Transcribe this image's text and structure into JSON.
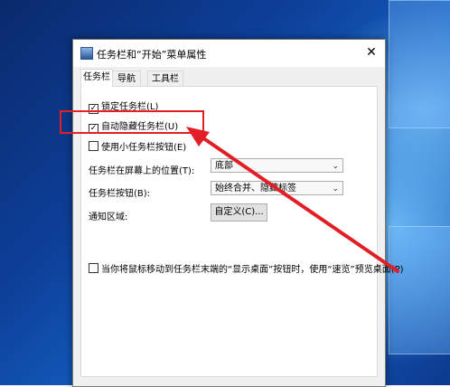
{
  "dialog": {
    "title": "任务栏和“开始”菜单属性",
    "close_glyph": "✕"
  },
  "tabs": [
    {
      "label": "任务栏",
      "active": true
    },
    {
      "label": "导航",
      "active": false
    },
    {
      "label": "工具栏",
      "active": false
    }
  ],
  "options": {
    "lock_taskbar": {
      "label": "锁定任务栏(L)",
      "checked": true
    },
    "auto_hide": {
      "label": "自动隐藏任务栏(U)",
      "checked": true
    },
    "small_buttons": {
      "label": "使用小任务栏按钮(E)",
      "checked": false
    },
    "peek": {
      "label": "当你将鼠标移动到任务栏末端的“显示桌面”按钮时，使用“速览”预览桌面(P)",
      "checked": false
    }
  },
  "location": {
    "label": "任务栏在屏幕上的位置(T):",
    "value": "底部"
  },
  "buttons_combine": {
    "label": "任务栏按钮(B):",
    "value": "始终合并、隐藏标签"
  },
  "notification": {
    "label": "通知区域:",
    "button_label": "自定义(C)..."
  },
  "annotation": {
    "color": "#e21f26"
  },
  "icons": {
    "check": "✓",
    "caret": "⌄"
  }
}
